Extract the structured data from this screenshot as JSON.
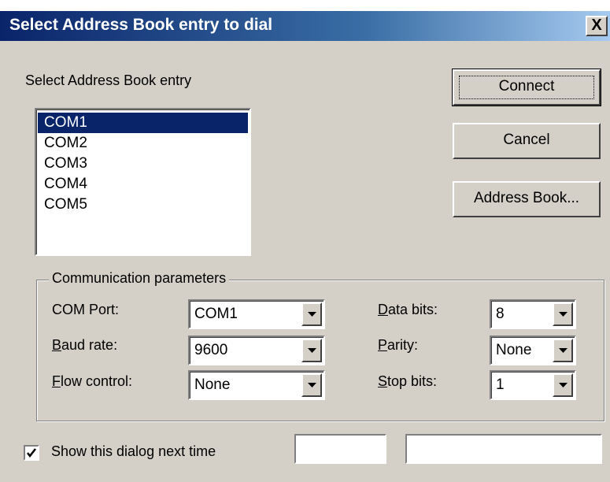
{
  "window": {
    "title": "Select Address Book entry to dial",
    "close_glyph": "X"
  },
  "entry_list": {
    "label": "Select Address Book entry",
    "items": [
      "COM1",
      "COM2",
      "COM3",
      "COM4",
      "COM5"
    ],
    "selected": "COM1"
  },
  "buttons": {
    "connect": "Connect",
    "cancel": "Cancel",
    "address_book": "Address Book..."
  },
  "comm_params": {
    "group_label": "Communication parameters",
    "com_port": {
      "pre": "",
      "u": "",
      "post": "COM Port:",
      "value": "COM1"
    },
    "baud_rate": {
      "pre": "",
      "u": "B",
      "post": "aud rate:",
      "value": "9600"
    },
    "flow_control": {
      "pre": "",
      "u": "F",
      "post": "low control:",
      "value": "None"
    },
    "data_bits": {
      "pre": "",
      "u": "D",
      "post": "ata bits:",
      "value": "8"
    },
    "parity": {
      "pre": "",
      "u": "P",
      "post": "arity:",
      "value": "None"
    },
    "stop_bits": {
      "pre": "",
      "u": "S",
      "post": "top bits:",
      "value": "1"
    }
  },
  "footer": {
    "show_dialog_label": "Show this dialog next time",
    "show_dialog_checked": true,
    "field1_value": "",
    "field2_value": ""
  },
  "colors": {
    "dialog_bg": "#d4d0c8",
    "title_start": "#0a246a",
    "title_end": "#a6caf0",
    "selection": "#0a246a"
  }
}
